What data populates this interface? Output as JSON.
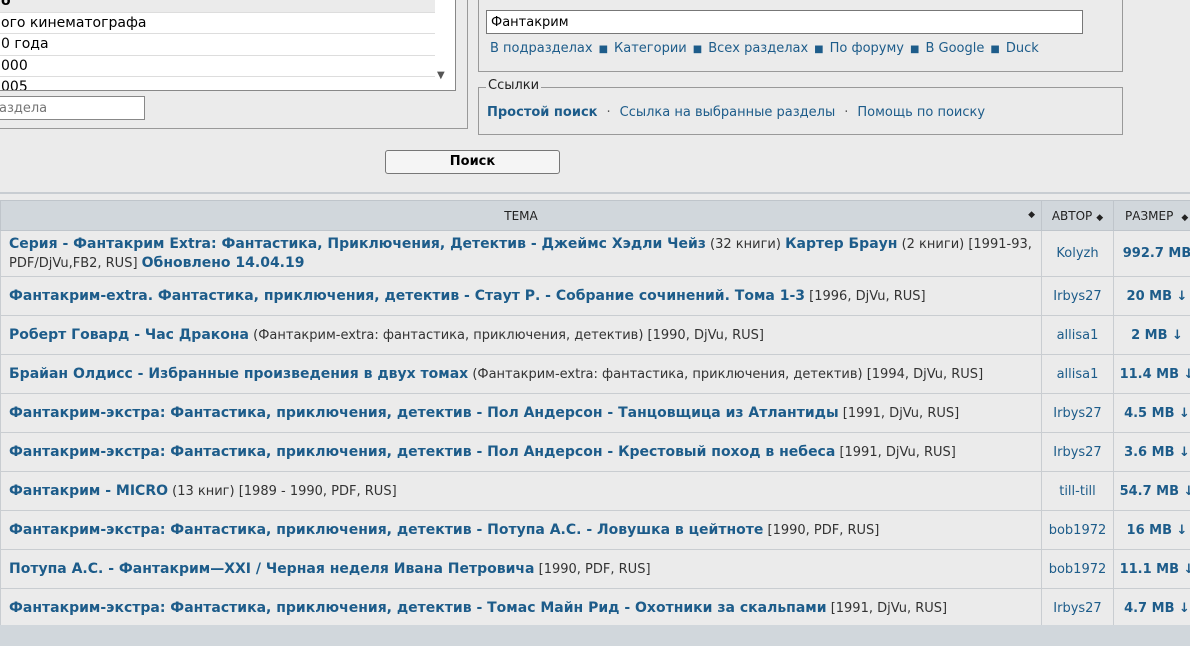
{
  "forum_list": {
    "options": [
      "о",
      "ого кинематографа",
      "0 года",
      "000",
      "005"
    ],
    "section_input_placeholder": "аздела"
  },
  "search": {
    "query": "Фантакрим",
    "scopes": [
      "В подразделах",
      "Категории",
      "Всех разделах",
      "По форуму",
      "В Google",
      "Duck"
    ],
    "button": "Поиск"
  },
  "links_box": {
    "legend": "Ссылки",
    "simple": "Простой поиск",
    "selected": "Ссылка на выбранные разделы",
    "help": "Помощь по поиску"
  },
  "table": {
    "headers": {
      "topic": "ТЕМА",
      "author": "АВТОР",
      "size": "РАЗМЕР"
    },
    "rows": [
      {
        "title": "Серия - Фантакрим Extra: Фантастика, Приключения, Детектив - Джеймс Хэдли Чейз",
        "details": " (32 книги) ",
        "title2": "Картер Браун",
        "details2": " (2 книги) [1991-93, PDF/DjVu,FB2, RUS] ",
        "updated": "Обновлено 14.04.19",
        "author": "Kolyzh",
        "size": "992.7 MB"
      },
      {
        "title": "Фантакрим-extra. Фантастика, приключения, детектив - Стаут Р. - Собрание сочинений. Тома 1-3",
        "details": " [1996, DjVu, RUS]",
        "author": "Irbys27",
        "size": "20 MB ↓"
      },
      {
        "title": "Роберт Говард - Час Дракона",
        "details": " (Фантакрим-extra: фантастика, приключения, детектив) [1990, DjVu, RUS]",
        "author": "allisa1",
        "size": "2 MB ↓"
      },
      {
        "title": "Брайан Олдисс - Избранные произведения в двух томах",
        "details": " (Фантакрим-extra: фантастика, приключения, детектив) [1994, DjVu, RUS]",
        "author": "allisa1",
        "size": "11.4 MB ↓"
      },
      {
        "title": "Фантакрим-экстра: Фантастика, приключения, детектив - Пол Андерсон - Танцовщица из Атлантиды",
        "details": " [1991, DjVu, RUS]",
        "author": "Irbys27",
        "size": "4.5 MB ↓"
      },
      {
        "title": "Фантакрим-экстра: Фантастика, приключения, детектив - Пол Андерсон - Крестовый поход в небеса",
        "details": " [1991, DjVu, RUS]",
        "author": "Irbys27",
        "size": "3.6 MB ↓"
      },
      {
        "title": "Фантакрим - MICRO",
        "details": " (13 книг) [1989 - 1990, PDF, RUS]",
        "author": "till-till",
        "size": "54.7 MB ↓"
      },
      {
        "title": "Фантакрим-экстра: Фантастика, приключения, детектив - Потупа А.С. - Ловушка в цейтноте",
        "details": " [1990, PDF, RUS]",
        "author": "bob1972",
        "size": "16 MB ↓"
      },
      {
        "title": "Потупа А.С. - Фантакрим—XXI / Черная неделя Ивана Петровича",
        "details": " [1990, PDF, RUS]",
        "author": "bob1972",
        "size": "11.1 MB ↓"
      },
      {
        "title": "Фантакрим-экстра: Фантастика, приключения, детектив - Томас Майн Рид - Охотники за скальпами",
        "details": " [1991, DjVu, RUS]",
        "author": "Irbys27",
        "size": "4.7 MB ↓"
      }
    ]
  }
}
